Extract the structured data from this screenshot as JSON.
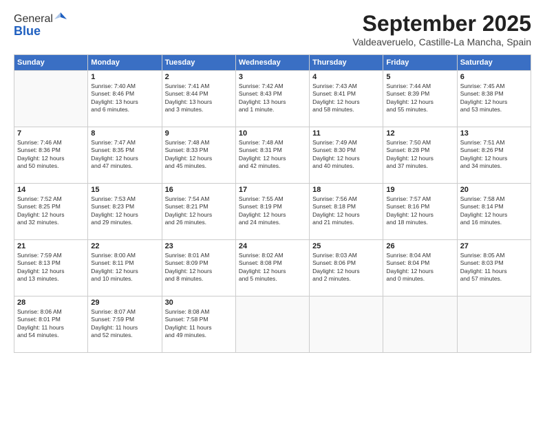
{
  "logo": {
    "general": "General",
    "blue": "Blue"
  },
  "header": {
    "month": "September 2025",
    "location": "Valdeaveruelo, Castille-La Mancha, Spain"
  },
  "weekdays": [
    "Sunday",
    "Monday",
    "Tuesday",
    "Wednesday",
    "Thursday",
    "Friday",
    "Saturday"
  ],
  "weeks": [
    [
      {
        "day": "",
        "info": ""
      },
      {
        "day": "1",
        "info": "Sunrise: 7:40 AM\nSunset: 8:46 PM\nDaylight: 13 hours\nand 6 minutes."
      },
      {
        "day": "2",
        "info": "Sunrise: 7:41 AM\nSunset: 8:44 PM\nDaylight: 13 hours\nand 3 minutes."
      },
      {
        "day": "3",
        "info": "Sunrise: 7:42 AM\nSunset: 8:43 PM\nDaylight: 13 hours\nand 1 minute."
      },
      {
        "day": "4",
        "info": "Sunrise: 7:43 AM\nSunset: 8:41 PM\nDaylight: 12 hours\nand 58 minutes."
      },
      {
        "day": "5",
        "info": "Sunrise: 7:44 AM\nSunset: 8:39 PM\nDaylight: 12 hours\nand 55 minutes."
      },
      {
        "day": "6",
        "info": "Sunrise: 7:45 AM\nSunset: 8:38 PM\nDaylight: 12 hours\nand 53 minutes."
      }
    ],
    [
      {
        "day": "7",
        "info": "Sunrise: 7:46 AM\nSunset: 8:36 PM\nDaylight: 12 hours\nand 50 minutes."
      },
      {
        "day": "8",
        "info": "Sunrise: 7:47 AM\nSunset: 8:35 PM\nDaylight: 12 hours\nand 47 minutes."
      },
      {
        "day": "9",
        "info": "Sunrise: 7:48 AM\nSunset: 8:33 PM\nDaylight: 12 hours\nand 45 minutes."
      },
      {
        "day": "10",
        "info": "Sunrise: 7:48 AM\nSunset: 8:31 PM\nDaylight: 12 hours\nand 42 minutes."
      },
      {
        "day": "11",
        "info": "Sunrise: 7:49 AM\nSunset: 8:30 PM\nDaylight: 12 hours\nand 40 minutes."
      },
      {
        "day": "12",
        "info": "Sunrise: 7:50 AM\nSunset: 8:28 PM\nDaylight: 12 hours\nand 37 minutes."
      },
      {
        "day": "13",
        "info": "Sunrise: 7:51 AM\nSunset: 8:26 PM\nDaylight: 12 hours\nand 34 minutes."
      }
    ],
    [
      {
        "day": "14",
        "info": "Sunrise: 7:52 AM\nSunset: 8:25 PM\nDaylight: 12 hours\nand 32 minutes."
      },
      {
        "day": "15",
        "info": "Sunrise: 7:53 AM\nSunset: 8:23 PM\nDaylight: 12 hours\nand 29 minutes."
      },
      {
        "day": "16",
        "info": "Sunrise: 7:54 AM\nSunset: 8:21 PM\nDaylight: 12 hours\nand 26 minutes."
      },
      {
        "day": "17",
        "info": "Sunrise: 7:55 AM\nSunset: 8:19 PM\nDaylight: 12 hours\nand 24 minutes."
      },
      {
        "day": "18",
        "info": "Sunrise: 7:56 AM\nSunset: 8:18 PM\nDaylight: 12 hours\nand 21 minutes."
      },
      {
        "day": "19",
        "info": "Sunrise: 7:57 AM\nSunset: 8:16 PM\nDaylight: 12 hours\nand 18 minutes."
      },
      {
        "day": "20",
        "info": "Sunrise: 7:58 AM\nSunset: 8:14 PM\nDaylight: 12 hours\nand 16 minutes."
      }
    ],
    [
      {
        "day": "21",
        "info": "Sunrise: 7:59 AM\nSunset: 8:13 PM\nDaylight: 12 hours\nand 13 minutes."
      },
      {
        "day": "22",
        "info": "Sunrise: 8:00 AM\nSunset: 8:11 PM\nDaylight: 12 hours\nand 10 minutes."
      },
      {
        "day": "23",
        "info": "Sunrise: 8:01 AM\nSunset: 8:09 PM\nDaylight: 12 hours\nand 8 minutes."
      },
      {
        "day": "24",
        "info": "Sunrise: 8:02 AM\nSunset: 8:08 PM\nDaylight: 12 hours\nand 5 minutes."
      },
      {
        "day": "25",
        "info": "Sunrise: 8:03 AM\nSunset: 8:06 PM\nDaylight: 12 hours\nand 2 minutes."
      },
      {
        "day": "26",
        "info": "Sunrise: 8:04 AM\nSunset: 8:04 PM\nDaylight: 12 hours\nand 0 minutes."
      },
      {
        "day": "27",
        "info": "Sunrise: 8:05 AM\nSunset: 8:03 PM\nDaylight: 11 hours\nand 57 minutes."
      }
    ],
    [
      {
        "day": "28",
        "info": "Sunrise: 8:06 AM\nSunset: 8:01 PM\nDaylight: 11 hours\nand 54 minutes."
      },
      {
        "day": "29",
        "info": "Sunrise: 8:07 AM\nSunset: 7:59 PM\nDaylight: 11 hours\nand 52 minutes."
      },
      {
        "day": "30",
        "info": "Sunrise: 8:08 AM\nSunset: 7:58 PM\nDaylight: 11 hours\nand 49 minutes."
      },
      {
        "day": "",
        "info": ""
      },
      {
        "day": "",
        "info": ""
      },
      {
        "day": "",
        "info": ""
      },
      {
        "day": "",
        "info": ""
      }
    ]
  ]
}
